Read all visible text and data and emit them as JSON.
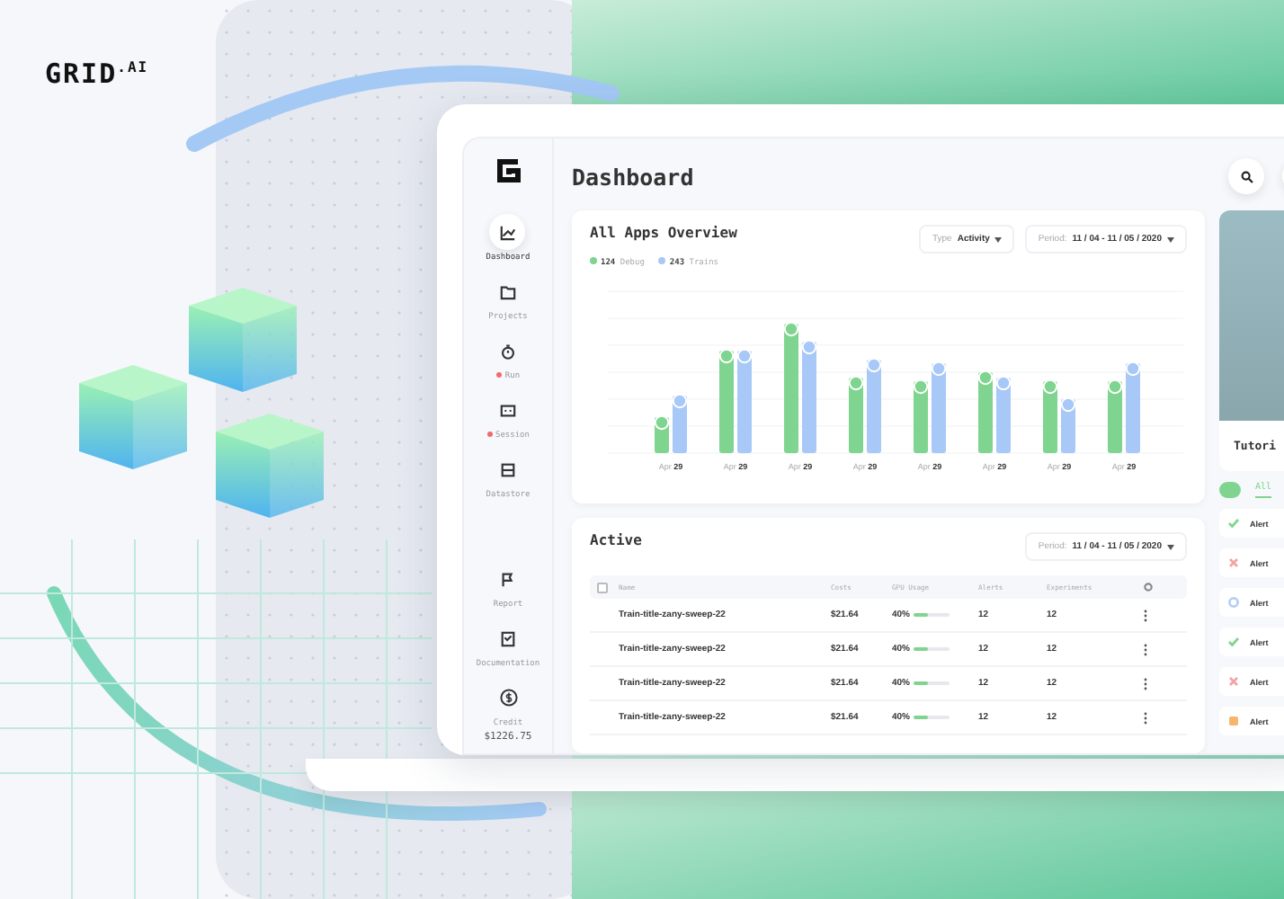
{
  "logo": "GRID$^{.AI}$",
  "sidebar": {
    "items": [
      {
        "label": "Dashboard",
        "selected": true,
        "flag": false
      },
      {
        "label": "Projects",
        "selected": false,
        "flag": false
      },
      {
        "label": "Run",
        "selected": false,
        "flag": true
      },
      {
        "label": "Session",
        "selected": false,
        "flag": true
      },
      {
        "label": "Datastore",
        "selected": false,
        "flag": false
      }
    ],
    "footer": [
      {
        "label": "Report"
      },
      {
        "label": "Documentation"
      }
    ],
    "credit": {
      "label": "Credit",
      "value": "$1226.75"
    }
  },
  "header": {
    "title": "Dashboard"
  },
  "overview": {
    "title": "All Apps Overview",
    "legend": [
      {
        "count": "124",
        "label": "Debug",
        "color": "#7fd58f"
      },
      {
        "count": "243",
        "label": "Trains",
        "color": "#a8c8f8"
      }
    ],
    "filters": [
      {
        "label": "Type",
        "value": "Activity"
      },
      {
        "label": "Period:",
        "value": "11 / 04 - 11 / 05 / 2020"
      }
    ],
    "x_labels": [
      {
        "month": "Apr",
        "day": "29"
      },
      {
        "month": "Apr",
        "day": "29"
      },
      {
        "month": "Apr",
        "day": "29"
      },
      {
        "month": "Apr",
        "day": "29"
      },
      {
        "month": "Apr",
        "day": "29"
      },
      {
        "month": "Apr",
        "day": "29"
      },
      {
        "month": "Apr",
        "day": "29"
      },
      {
        "month": "Apr",
        "day": "29"
      }
    ]
  },
  "active": {
    "title": "Active",
    "filter": {
      "label": "Period:",
      "value": "11 / 04 - 11 / 05 / 2020"
    },
    "select_all": {
      "checked": false
    },
    "columns": [
      "Name",
      "Costs",
      "GPU Usage",
      "Alerts",
      "Experiments"
    ],
    "rows": [
      {
        "name": "Train-title-zany-sweep-22",
        "cost": "$21.64",
        "usage": "40%",
        "level": 0.4,
        "alerts": "12",
        "experiments": "12"
      },
      {
        "name": "Train-title-zany-sweep-22",
        "cost": "$21.64",
        "usage": "40%",
        "level": 0.4,
        "alerts": "12",
        "experiments": "12"
      },
      {
        "name": "Train-title-zany-sweep-22",
        "cost": "$21.64",
        "usage": "40%",
        "level": 0.4,
        "alerts": "12",
        "experiments": "12"
      },
      {
        "name": "Train-title-zany-sweep-22",
        "cost": "$21.64",
        "usage": "40%",
        "level": 0.4,
        "alerts": "12",
        "experiments": "12"
      }
    ]
  },
  "tutorial": {
    "title": "Tutori"
  },
  "alert_tabs": [
    {
      "label": "All",
      "selected": true
    }
  ],
  "alerts": [
    {
      "kind": "ok",
      "label": "Alert",
      "color": "#7fd58f"
    },
    {
      "kind": "error",
      "label": "Alert",
      "color": "#f3a3a3"
    },
    {
      "kind": "info",
      "label": "Alert",
      "color": "#b5cdf6"
    },
    {
      "kind": "ok",
      "label": "Alert",
      "color": "#7fd58f"
    },
    {
      "kind": "error",
      "label": "Alert",
      "color": "#f3a3a3"
    },
    {
      "kind": "warning",
      "label": "Alert",
      "color": "#f6b56a"
    }
  ]
}
